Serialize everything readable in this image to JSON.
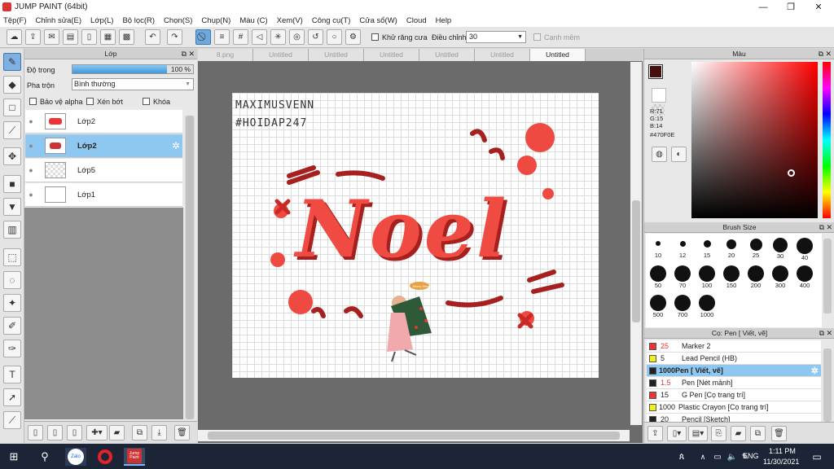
{
  "window": {
    "title": "JUMP PAINT (64bit)"
  },
  "menu": [
    "Tệp(F)",
    "Chỉnh sửa(E)",
    "Lớp(L)",
    "Bộ lọc(R)",
    "Chọn(S)",
    "Chụp(N)",
    "Màu (C)",
    "Xem(V)",
    "Công cụ(T)",
    "Cửa sổ(W)",
    "Cloud",
    "Help"
  ],
  "toolbar": {
    "antialias_label": "Khử răng cưa",
    "adjust_label": "Điều chỉnh",
    "adjust_value": "30",
    "snap_label": "Cạnh mềm"
  },
  "layers": {
    "title": "Lớp",
    "opacity_label": "Độ trong",
    "opacity_value": "100 %",
    "blend_label": "Pha trộn",
    "blend_value": "Bình thường",
    "protect_alpha": "Bảo vệ alpha",
    "clip": "Xén bớt",
    "lock": "Khóa",
    "items": [
      {
        "name": "Lớp2"
      },
      {
        "name": "Lớp2"
      },
      {
        "name": "Lớp5"
      },
      {
        "name": "Lớp1"
      }
    ]
  },
  "tabs": [
    "8.png",
    "Untitled",
    "Untitled",
    "Untitled",
    "Untitled",
    "Untitled",
    "Untitled"
  ],
  "canvas": {
    "watermark_line1": "MAXIMUSVENN",
    "watermark_line2": "#HOIDAP247",
    "art_text": "Noel",
    "bubble_text": "Merry Xmas"
  },
  "color": {
    "title": "Màu",
    "r": "R:71",
    "g": "G:15",
    "b": "B:14",
    "hex": "#470F0E",
    "fg": "#470F0E"
  },
  "brush": {
    "title": "Brush Size",
    "sizes": [
      "10",
      "12",
      "15",
      "20",
      "25",
      "30",
      "40",
      "50",
      "70",
      "100",
      "150",
      "200",
      "300",
      "400",
      "500",
      "700",
      "1000"
    ]
  },
  "pens": {
    "title": "Cọ: Pen [ Viết, vẽ]",
    "items": [
      {
        "size": "25",
        "name": "Marker 2",
        "color": "#e33"
      },
      {
        "size": "5",
        "name": "Lead Pencil (HB)",
        "color": "#ee2"
      },
      {
        "size": "1000",
        "name": "Pen [ Viết, vẽ]",
        "color": "#222"
      },
      {
        "size": "1.5",
        "name": "Pen [Nét mảnh]",
        "color": "#222"
      },
      {
        "size": "15",
        "name": "G Pen [Cọ trang trí]",
        "color": "#e33"
      },
      {
        "size": "1000",
        "name": "Plastic Crayon [Cọ trang trí]",
        "color": "#ee2"
      },
      {
        "size": "20",
        "name": "Pencil [Sketch]",
        "color": "#222"
      }
    ]
  },
  "taskbar": {
    "lang": "ENG",
    "time": "1:11 PM",
    "date": "11/30/2021",
    "apps": [
      "Zalo",
      "Opera",
      "Jump Paint"
    ]
  }
}
